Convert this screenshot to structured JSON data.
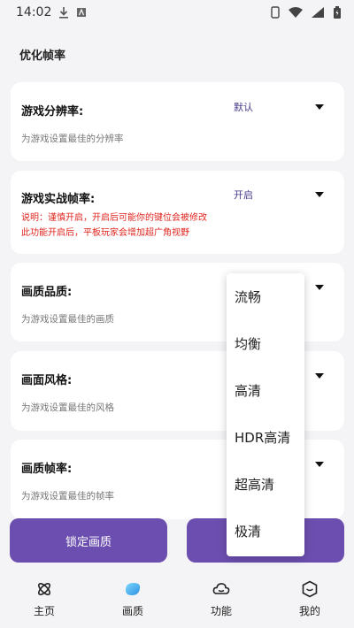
{
  "status": {
    "time": "14:02"
  },
  "page": {
    "title": "优化帧率"
  },
  "cards": [
    {
      "title": "游戏分辨率:",
      "value": "默认",
      "desc": "为游戏设置最佳的分辨率"
    },
    {
      "title": "游戏实战帧率:",
      "value": "开启",
      "warn1": "说明：谨慎开启，开启后可能你的键位会被修改",
      "warn2": "此功能开启后，平板玩家会增加超广角视野"
    },
    {
      "title": "画质品质:",
      "desc": "为游戏设置最佳的画质"
    },
    {
      "title": "画面风格:",
      "desc": "为游戏设置最佳的风格"
    },
    {
      "title": "画质帧率:",
      "desc": "为游戏设置最佳的帧率"
    }
  ],
  "buttons": {
    "lock": "锁定画质"
  },
  "dropdown": {
    "options": [
      "流畅",
      "均衡",
      "高清",
      "HDR高清",
      "超高清",
      "极清"
    ]
  },
  "nav": [
    {
      "label": "主页",
      "icon": "atom-icon"
    },
    {
      "label": "画质",
      "icon": "gem-icon"
    },
    {
      "label": "功能",
      "icon": "cloud-icon"
    },
    {
      "label": "我的",
      "icon": "hexagon-face-icon"
    }
  ],
  "colors": {
    "accent": "#6c4eb0",
    "warn": "#e0261f",
    "value": "#4a3a8a"
  }
}
